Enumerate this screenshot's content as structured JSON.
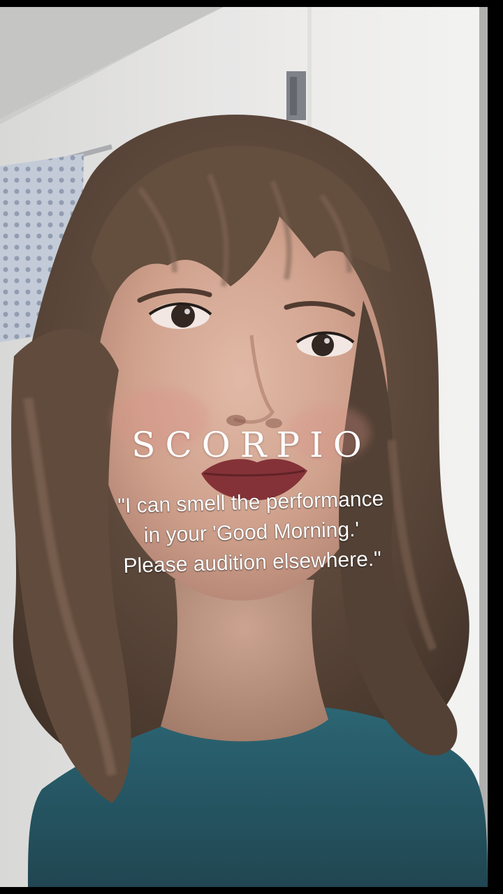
{
  "overlay": {
    "title": "SCORPIO",
    "quote_lines": [
      "\"I can smell the performance",
      "in your 'Good Morning.'",
      "Please audition elsewhere.\""
    ]
  },
  "colors": {
    "frame": "#000000",
    "wall": "#e8e7e5",
    "ceiling": "#cfcfcd",
    "curtain": "#8f9bb0",
    "hair": "#5a4536",
    "skin": "#c9a38f",
    "lips": "#7f2a30",
    "shirt": "#1f5565",
    "text": "#ffffff"
  }
}
